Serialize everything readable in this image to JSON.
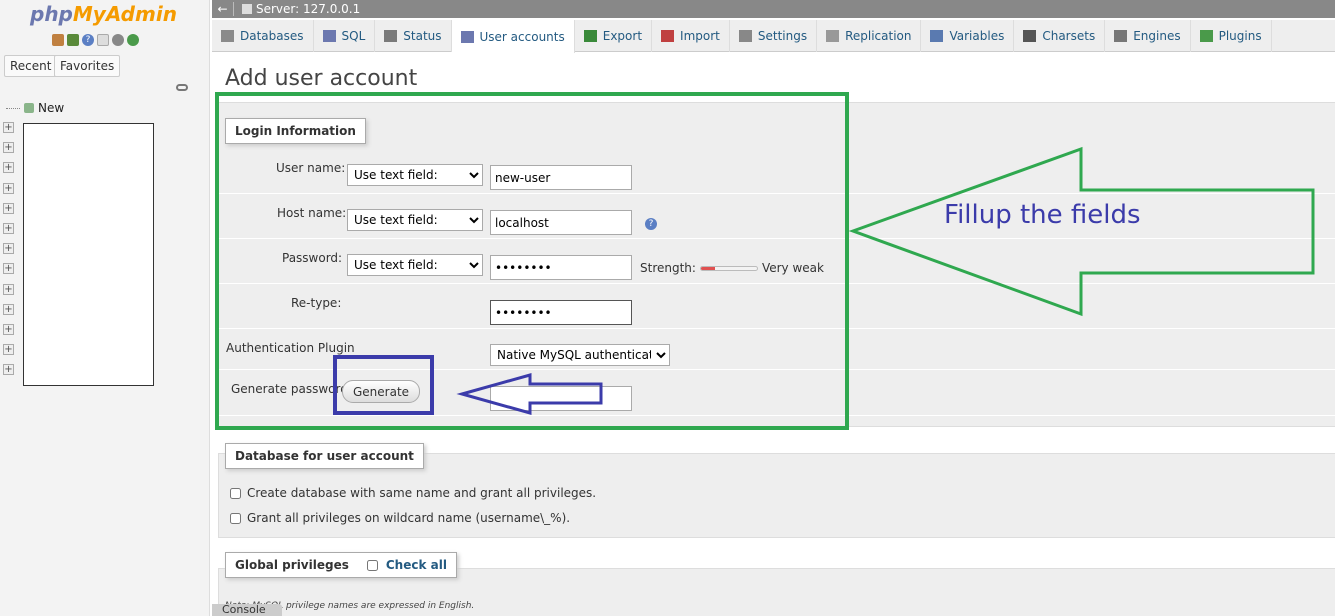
{
  "nav": {
    "logo_php": "php",
    "logo_my": "MyAdmin",
    "icons": [
      "home-icon",
      "exit-icon",
      "help-icon",
      "docs-icon",
      "settings-icon",
      "reload-icon"
    ],
    "tab_recent": "Recent",
    "tab_favorites": "Favorites",
    "tree_new": "New"
  },
  "server_bar": {
    "label": "Server: 127.0.0.1"
  },
  "tabs": [
    {
      "label": "Databases",
      "icon": "database-icon"
    },
    {
      "label": "SQL",
      "icon": "sql-icon"
    },
    {
      "label": "Status",
      "icon": "status-icon"
    },
    {
      "label": "User accounts",
      "icon": "user-accounts-icon",
      "active": true
    },
    {
      "label": "Export",
      "icon": "export-icon"
    },
    {
      "label": "Import",
      "icon": "import-icon"
    },
    {
      "label": "Settings",
      "icon": "settings-icon"
    },
    {
      "label": "Replication",
      "icon": "replication-icon"
    },
    {
      "label": "Variables",
      "icon": "variables-icon"
    },
    {
      "label": "Charsets",
      "icon": "charsets-icon"
    },
    {
      "label": "Engines",
      "icon": "engines-icon"
    },
    {
      "label": "Plugins",
      "icon": "plugins-icon"
    }
  ],
  "page_title": "Add user account",
  "login": {
    "legend": "Login Information",
    "user_name_label": "User name:",
    "user_name_select": "Use text field:",
    "user_name_value": "new-user",
    "host_name_label": "Host name:",
    "host_name_select": "Use text field:",
    "host_name_value": "localhost",
    "password_label": "Password:",
    "password_select": "Use text field:",
    "password_value": "••••••••",
    "strength_label": "Strength:",
    "strength_text": "Very weak",
    "strength_level": 0.25,
    "retype_label": "Re-type:",
    "retype_value": "••••••••",
    "auth_plugin_label": "Authentication Plugin",
    "auth_plugin_value": "Native MySQL authentication",
    "generate_label": "Generate password:",
    "generate_button": "Generate"
  },
  "database_section": {
    "legend": "Database for user account",
    "option_create": "Create database with same name and grant all privileges.",
    "option_wildcard": "Grant all privileges on wildcard name (username\\_%)."
  },
  "global_privileges": {
    "legend": "Global privileges",
    "check_all": "Check all"
  },
  "note": "Note: MySQL privilege names are expressed in English.",
  "console_label": "Console",
  "annotation": {
    "text": "Fillup the fields",
    "green_color": "#2fa84f",
    "blue_color": "#3b3baa"
  }
}
